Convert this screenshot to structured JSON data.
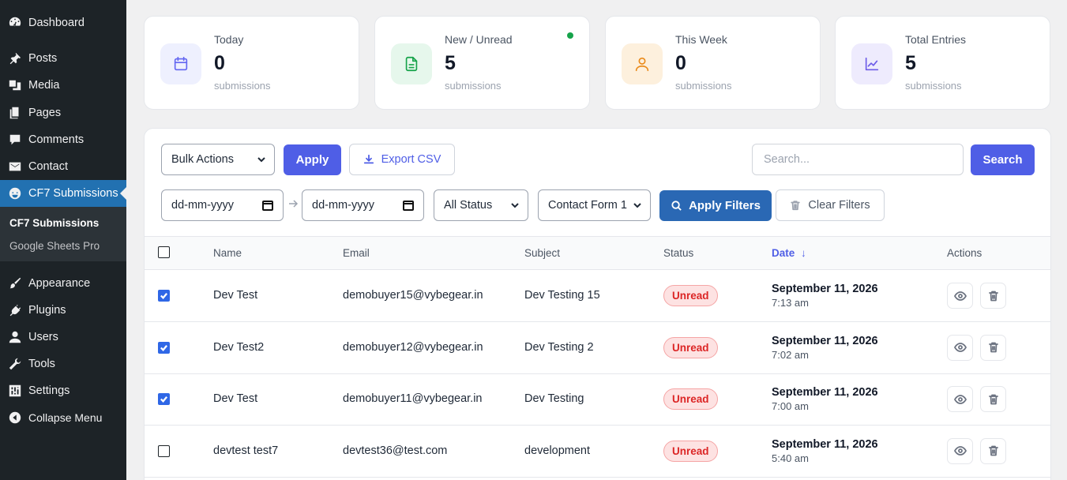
{
  "sidebar": {
    "items": [
      {
        "label": "Dashboard",
        "icon": "dashboard-icon"
      },
      {
        "label": "Posts",
        "icon": "pin-icon"
      },
      {
        "label": "Media",
        "icon": "media-icon"
      },
      {
        "label": "Pages",
        "icon": "pages-icon"
      },
      {
        "label": "Comments",
        "icon": "comment-icon"
      },
      {
        "label": "Contact",
        "icon": "mail-icon"
      },
      {
        "label": "CF7 Submissions",
        "icon": "cf7-icon"
      },
      {
        "label": "Appearance",
        "icon": "brush-icon"
      },
      {
        "label": "Plugins",
        "icon": "plug-icon"
      },
      {
        "label": "Users",
        "icon": "user-icon"
      },
      {
        "label": "Tools",
        "icon": "wrench-icon"
      },
      {
        "label": "Settings",
        "icon": "sliders-icon"
      },
      {
        "label": "Collapse Menu",
        "icon": "collapse-icon"
      }
    ],
    "submenu": [
      {
        "label": "CF7 Submissions"
      },
      {
        "label": "Google Sheets Pro"
      }
    ]
  },
  "cards": [
    {
      "label": "Today",
      "value": "0",
      "sub": "submissions",
      "icon": "calendar-icon",
      "color": "#6366f1",
      "bg": "#eef0fe"
    },
    {
      "label": "New / Unread",
      "value": "5",
      "sub": "submissions",
      "icon": "file-icon",
      "color": "#16a34a",
      "bg": "#e6f7ec"
    },
    {
      "label": "This Week",
      "value": "0",
      "sub": "submissions",
      "icon": "user-icon",
      "color": "#ea8a1a",
      "bg": "#fdf0dd"
    },
    {
      "label": "Total Entries",
      "value": "5",
      "sub": "submissions",
      "icon": "chart-icon",
      "color": "#6d5ce8",
      "bg": "#eeebfd"
    }
  ],
  "toolbar": {
    "bulk_actions": "Bulk Actions",
    "apply": "Apply",
    "export_csv": "Export CSV",
    "search_placeholder": "Search...",
    "search_button": "Search"
  },
  "filters": {
    "date_from_placeholder": "dd-mm-yyyy",
    "date_to_placeholder": "dd-mm-yyyy",
    "status": "All Status",
    "form": "Contact Form 1",
    "apply_filters": "Apply Filters",
    "clear_filters": "Clear Filters"
  },
  "table": {
    "headers": {
      "name": "Name",
      "email": "Email",
      "subject": "Subject",
      "status": "Status",
      "date": "Date",
      "actions": "Actions"
    },
    "rows": [
      {
        "checked": true,
        "name": "Dev Test",
        "email": "demobuyer15@vybegear.in",
        "subject": "Dev Testing 15",
        "status": "Unread",
        "date": "September 11, 2026",
        "time": "7:13 am"
      },
      {
        "checked": true,
        "name": "Dev Test2",
        "email": "demobuyer12@vybegear.in",
        "subject": "Dev Testing 2",
        "status": "Unread",
        "date": "September 11, 2026",
        "time": "7:02 am"
      },
      {
        "checked": true,
        "name": "Dev Test",
        "email": "demobuyer11@vybegear.in",
        "subject": "Dev Testing",
        "status": "Unread",
        "date": "September 11, 2026",
        "time": "7:00 am"
      },
      {
        "checked": false,
        "name": "devtest test7",
        "email": "devtest36@test.com",
        "subject": "development",
        "status": "Unread",
        "date": "September 11, 2026",
        "time": "5:40 am"
      }
    ]
  }
}
